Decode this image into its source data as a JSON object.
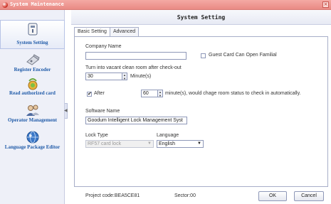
{
  "window": {
    "title": "System Maintenance",
    "close_glyph": "×"
  },
  "sidebar": {
    "items": [
      {
        "label": "System Setting",
        "icon": "system-setting-icon",
        "active": true
      },
      {
        "label": "Register Encoder",
        "icon": "register-encoder-icon"
      },
      {
        "label": "Read authorized card",
        "icon": "read-card-icon"
      },
      {
        "label": "Operator Management",
        "icon": "operator-icon"
      },
      {
        "label": "Language Package Editor",
        "icon": "globe-icon"
      }
    ]
  },
  "header": {
    "title": "System Setting"
  },
  "tabs": [
    {
      "label": "Basic Setting",
      "active": true
    },
    {
      "label": "Advanced",
      "active": false
    }
  ],
  "form": {
    "company_name_label": "Company Name",
    "company_name_value": "",
    "guest_card_label": "Guest Card Can Open Familial",
    "guest_card_checked": false,
    "vacant_label": "Turn into vacant clean room after check-out",
    "vacant_value": "30",
    "vacant_unit": "Minute(s)",
    "after_label": "After",
    "after_checked": true,
    "after_value": "60",
    "after_suffix": "minute(s), would chage room status to check in automatically.",
    "software_name_label": "Software Name",
    "software_name_value": "Goodum Intelligent Lock Management Syst",
    "lock_type_label": "Lock Type",
    "lock_type_value": "RF57 card lock",
    "language_label": "Language",
    "language_value": "English"
  },
  "footer": {
    "project_code": "Project code:BEA5CE81",
    "sector": "Sector:00",
    "ok_label": "OK",
    "cancel_label": "Cancel"
  }
}
